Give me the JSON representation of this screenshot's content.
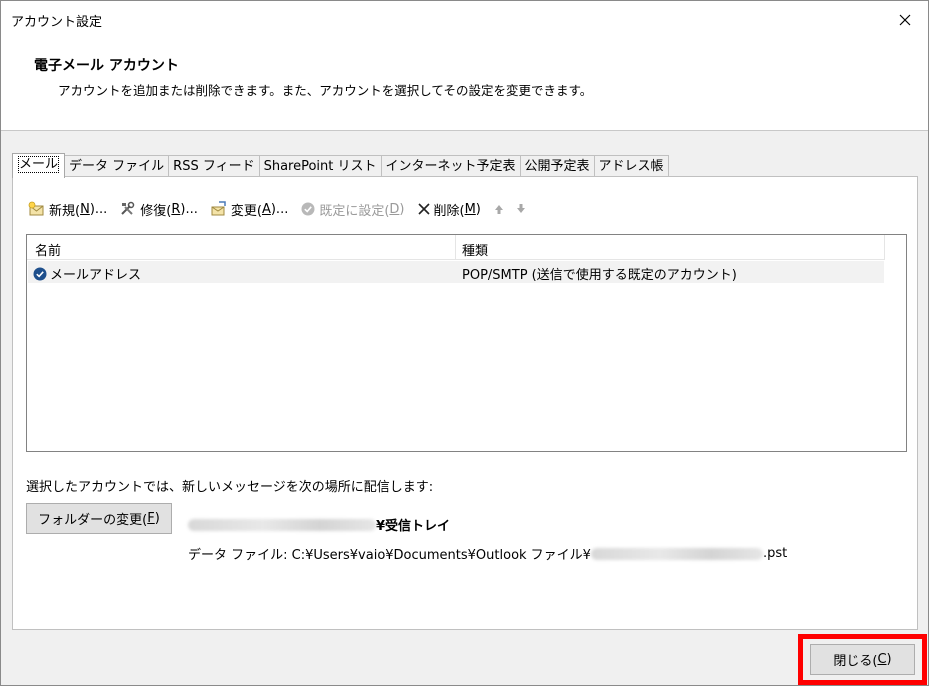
{
  "window": {
    "title": "アカウント設定"
  },
  "header": {
    "title": "電子メール アカウント",
    "description": "アカウントを追加または削除できます。また、アカウントを選択してその設定を変更できます。"
  },
  "tabs": [
    {
      "label": "メール",
      "active": true
    },
    {
      "label": "データ ファイル"
    },
    {
      "label": "RSS フィード"
    },
    {
      "label": "SharePoint リスト"
    },
    {
      "label": "インターネット予定表"
    },
    {
      "label": "公開予定表"
    },
    {
      "label": "アドレス帳"
    }
  ],
  "toolbar": {
    "new_label": "新規(",
    "new_key": "N",
    "new_suffix": ")...",
    "repair_label": "修復(",
    "repair_key": "R",
    "repair_suffix": ")...",
    "change_label": "変更(",
    "change_key": "A",
    "change_suffix": ")...",
    "default_label": "既定に設定(",
    "default_key": "D",
    "default_suffix": ")",
    "delete_label": "削除(",
    "delete_key": "M",
    "delete_suffix": ")"
  },
  "account_list": {
    "columns": [
      "名前",
      "種類"
    ],
    "rows": [
      {
        "name": "メールアドレス",
        "type": "POP/SMTP (送信で使用する既定のアカウント)"
      }
    ]
  },
  "delivery": {
    "label": "選択したアカウントでは、新しいメッセージを次の場所に配信します:",
    "folder_button_label": "フォルダーの変更(",
    "folder_button_key": "F",
    "folder_button_suffix": ")",
    "inbox_suffix": "¥受信トレイ",
    "data_file_prefix": "データ ファイル: C:¥Users¥vaio¥Documents¥Outlook ファイル¥",
    "data_file_suffix": ".pst"
  },
  "footer": {
    "close_label": "閉じる(",
    "close_key": "C",
    "close_suffix": ")"
  },
  "colors": {
    "highlight_border": "#ff0000",
    "check_icon": "#1e4f8c"
  }
}
